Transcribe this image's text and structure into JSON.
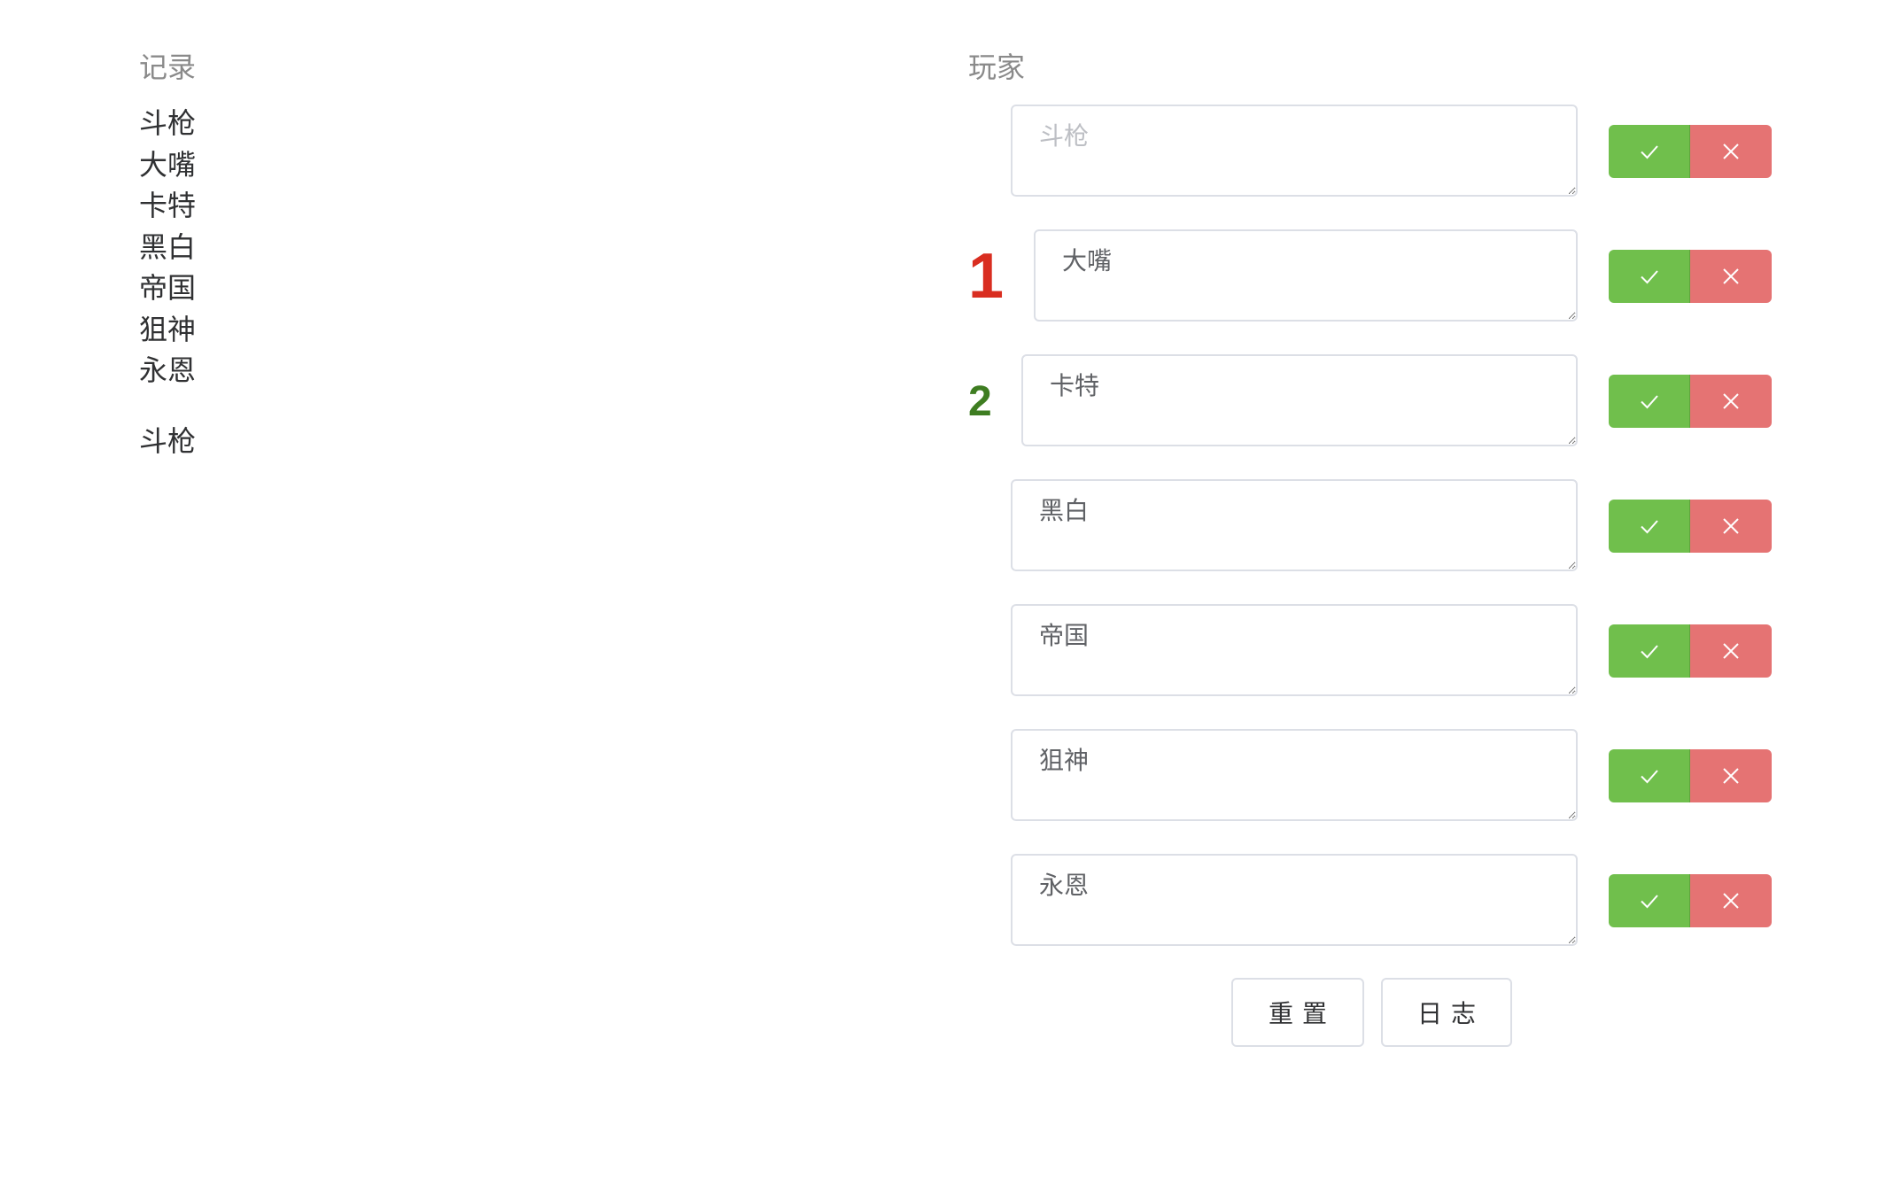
{
  "records": {
    "title": "记录",
    "items": [
      "斗枪",
      "大嘴",
      "卡特",
      "黑白",
      "帝国",
      "狙神",
      "永恩"
    ],
    "current": "斗枪"
  },
  "players": {
    "title": "玩家",
    "rows": [
      {
        "value": "",
        "placeholder": "斗枪",
        "rank": ""
      },
      {
        "value": "大嘴",
        "placeholder": "",
        "rank": "1"
      },
      {
        "value": "卡特",
        "placeholder": "",
        "rank": "2"
      },
      {
        "value": "黑白",
        "placeholder": "",
        "rank": ""
      },
      {
        "value": "帝国",
        "placeholder": "",
        "rank": ""
      },
      {
        "value": "狙神",
        "placeholder": "",
        "rank": ""
      },
      {
        "value": "永恩",
        "placeholder": "",
        "rank": ""
      }
    ]
  },
  "footer": {
    "reset_label": "重置",
    "log_label": "日志"
  },
  "colors": {
    "confirm": "#70bf4c",
    "reject": "#e57373",
    "rank_first": "#d92d20",
    "rank_second": "#3e7d21"
  },
  "icons": {
    "confirm": "check-icon",
    "reject": "close-icon"
  }
}
